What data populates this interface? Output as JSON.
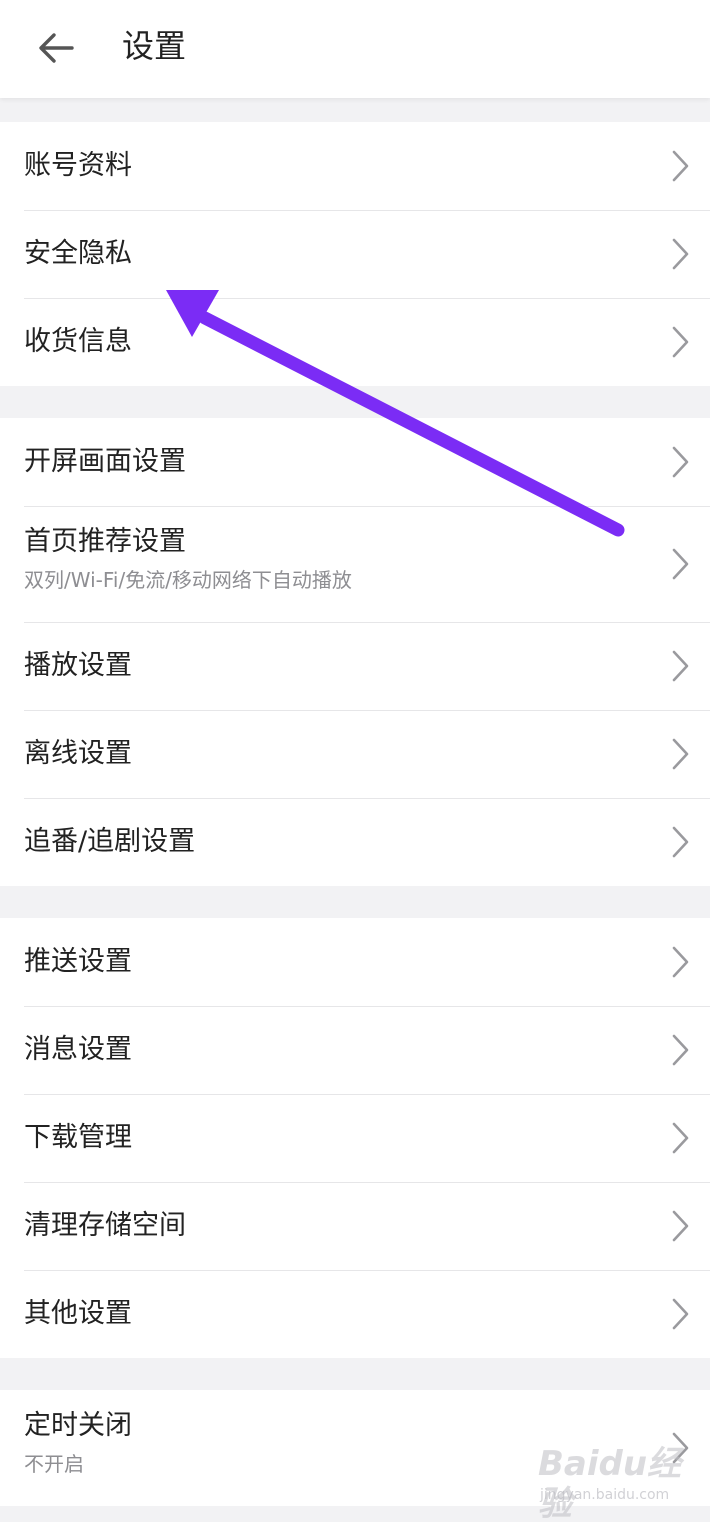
{
  "header": {
    "title": "设置",
    "back_icon": "arrow-left-icon"
  },
  "groups": [
    {
      "items": [
        {
          "label": "账号资料"
        },
        {
          "label": "安全隐私"
        },
        {
          "label": "收货信息"
        }
      ]
    },
    {
      "items": [
        {
          "label": "开屏画面设置"
        },
        {
          "label": "首页推荐设置",
          "subtitle": "双列/Wi-Fi/免流/移动网络下自动播放"
        },
        {
          "label": "播放设置"
        },
        {
          "label": "离线设置"
        },
        {
          "label": "追番/追剧设置"
        }
      ]
    },
    {
      "items": [
        {
          "label": "推送设置"
        },
        {
          "label": "消息设置"
        },
        {
          "label": "下载管理"
        },
        {
          "label": "清理存储空间"
        },
        {
          "label": "其他设置"
        }
      ]
    },
    {
      "items": [
        {
          "label": "定时关闭",
          "subtitle": "不开启"
        }
      ]
    }
  ],
  "annotation": {
    "arrow_color": "#7b2cf5",
    "points_to": "安全隐私"
  },
  "watermark": {
    "brand": "Baidu经验",
    "url": "jingyan.baidu.com"
  },
  "colors": {
    "background": "#f2f2f4",
    "row_background": "#ffffff",
    "divider": "#e6e6e8",
    "text_primary": "#222222",
    "text_secondary": "#8e8e92",
    "chevron": "#9a9a9e"
  }
}
